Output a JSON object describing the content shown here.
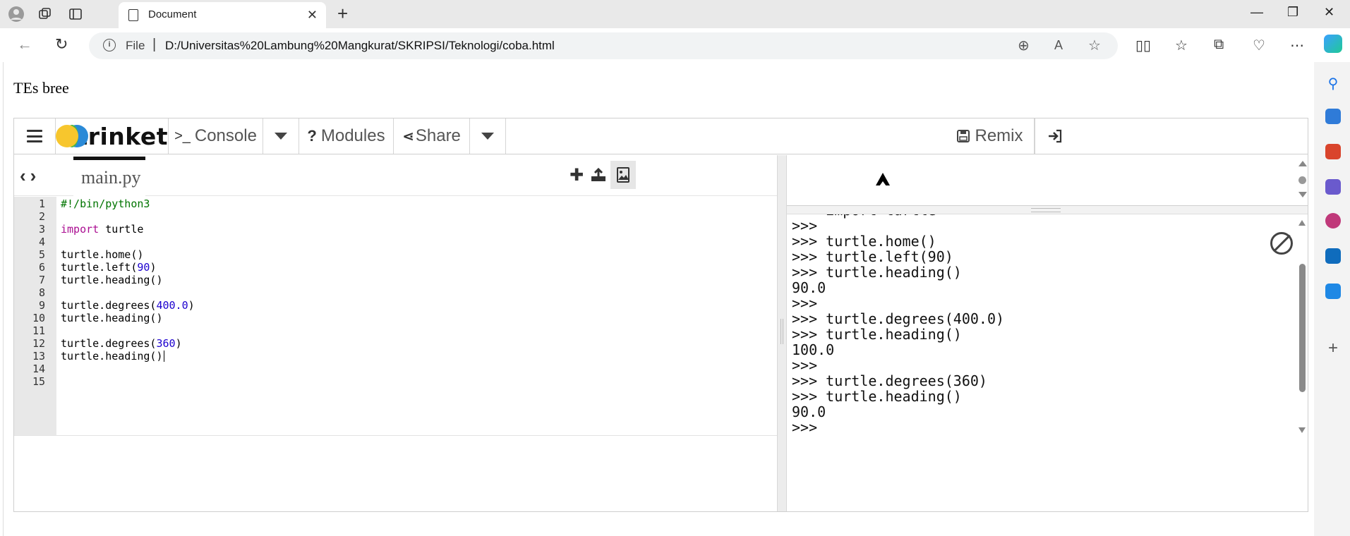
{
  "browser": {
    "tab_title": "Document",
    "url_scheme_label": "File",
    "url": "D:/Universitas%20Lambung%20Mangkurat/SKRIPSI/Teknologi/coba.html"
  },
  "page": {
    "heading": "TEs bree"
  },
  "trinket": {
    "logo_text": "trinket",
    "console_label": "Console",
    "modules_label": "Modules",
    "share_label": "Share",
    "remix_label": "Remix",
    "file_tab": "main.py",
    "code_lines": [
      "#!/bin/python3",
      "",
      "import turtle",
      "",
      "turtle.home()",
      "turtle.left(90)",
      "turtle.heading()",
      "",
      "turtle.degrees(400.0)",
      "turtle.heading()",
      "",
      "turtle.degrees(360)",
      "turtle.heading()",
      "",
      ""
    ],
    "active_line": 13,
    "console_lines": [
      ">>> import turtle",
      ">>>",
      ">>> turtle.home()",
      ">>> turtle.left(90)",
      ">>> turtle.heading()",
      "90.0",
      ">>>",
      ">>> turtle.degrees(400.0)",
      ">>> turtle.heading()",
      "100.0",
      ">>>",
      ">>> turtle.degrees(360)",
      ">>> turtle.heading()",
      "90.0",
      ">>>"
    ]
  },
  "colors": {
    "keyword": "#aa0d91",
    "number": "#1c00cf",
    "comment": "#007400",
    "logo_yellow": "#f7c62d",
    "logo_blue": "#2a8ad7",
    "logo_green": "#4bb748"
  }
}
